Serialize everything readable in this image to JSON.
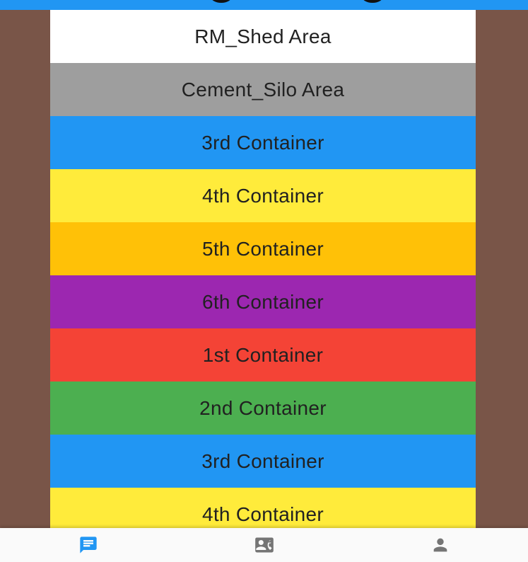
{
  "app_bar": {
    "color": "#2196F3"
  },
  "background_color": "#795548",
  "list": {
    "items": [
      {
        "label": "RM_Shed Area",
        "color": "#FFFFFF"
      },
      {
        "label": "Cement_Silo Area",
        "color": "#9E9E9E"
      },
      {
        "label": "3rd Container",
        "color": "#2196F3"
      },
      {
        "label": "4th Container",
        "color": "#FFEB3B"
      },
      {
        "label": "5th Container",
        "color": "#FFC107"
      },
      {
        "label": "6th Container",
        "color": "#9C27B0"
      },
      {
        "label": "1st Container",
        "color": "#F44336"
      },
      {
        "label": "2nd Container",
        "color": "#4CAF50"
      },
      {
        "label": "3rd Container",
        "color": "#2196F3"
      },
      {
        "label": "4th Container",
        "color": "#FFEB3B"
      }
    ]
  },
  "bottom_nav": {
    "items": [
      {
        "icon": "chat-icon",
        "active": true,
        "color": "#2196F3"
      },
      {
        "icon": "contact-mail-icon",
        "active": false,
        "color": "#757575"
      },
      {
        "icon": "person-icon",
        "active": false,
        "color": "#757575"
      }
    ]
  }
}
